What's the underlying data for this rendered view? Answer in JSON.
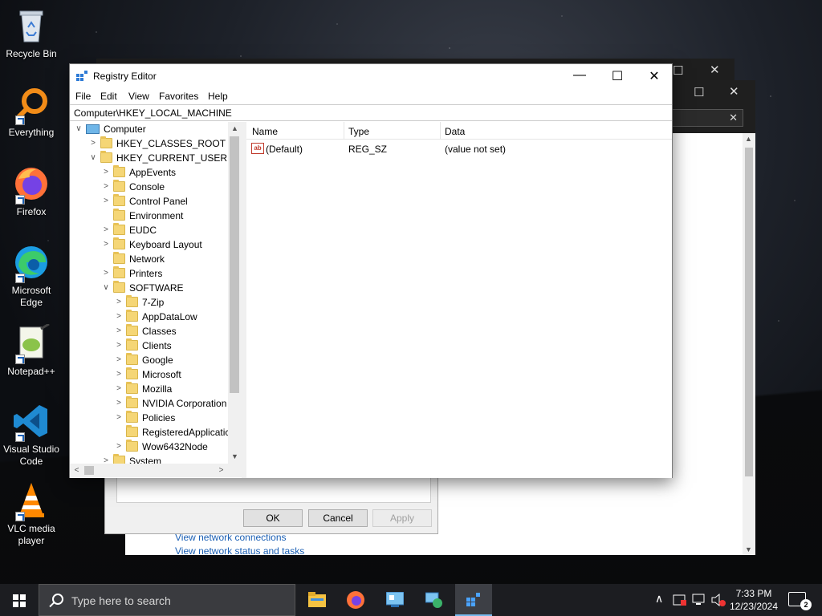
{
  "desktop": {
    "icons": [
      {
        "label": "Recycle Bin"
      },
      {
        "label": "Everything"
      },
      {
        "label": "Firefox"
      },
      {
        "label": "Microsoft Edge"
      },
      {
        "label": "Notepad++"
      },
      {
        "label": "Visual Studio Code"
      },
      {
        "label": "VLC media player"
      }
    ]
  },
  "background_window": {
    "links": [
      "View network connections",
      "View network status and tasks"
    ],
    "dialog": {
      "ok": "OK",
      "cancel": "Cancel",
      "apply": "Apply"
    }
  },
  "regedit": {
    "title": "Registry Editor",
    "menu": [
      "File",
      "Edit",
      "View",
      "Favorites",
      "Help"
    ],
    "address": "Computer\\HKEY_LOCAL_MACHINE",
    "tree": {
      "root": "Computer",
      "hives": [
        "HKEY_CLASSES_ROOT",
        "HKEY_CURRENT_USER"
      ],
      "hkcu_children": [
        "AppEvents",
        "Console",
        "Control Panel",
        "Environment",
        "EUDC",
        "Keyboard Layout",
        "Network",
        "Printers",
        "SOFTWARE"
      ],
      "software_children": [
        "7-Zip",
        "AppDataLow",
        "Classes",
        "Clients",
        "Google",
        "Microsoft",
        "Mozilla",
        "NVIDIA Corporation",
        "Policies",
        "RegisteredApplicatic",
        "Wow6432Node"
      ],
      "partial": "System"
    },
    "columns": {
      "name": "Name",
      "type": "Type",
      "data": "Data"
    },
    "values": [
      {
        "name": "(Default)",
        "type": "REG_SZ",
        "data": "(value not set)"
      }
    ]
  },
  "taskbar": {
    "search_placeholder": "Type here to search",
    "time": "7:33 PM",
    "date": "12/23/2024",
    "notification_count": "2"
  }
}
